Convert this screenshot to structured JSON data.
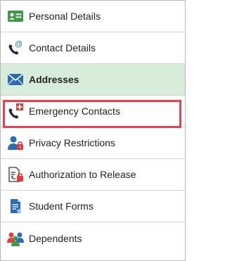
{
  "menu": {
    "items": [
      {
        "label": "Personal Details",
        "icon": "id-card-icon",
        "active": false
      },
      {
        "label": "Contact Details",
        "icon": "phone-at-icon",
        "active": false
      },
      {
        "label": "Addresses",
        "icon": "envelope-icon",
        "active": true
      },
      {
        "label": "Emergency Contacts",
        "icon": "phone-medical-icon",
        "active": false,
        "highlighted": true
      },
      {
        "label": "Privacy Restrictions",
        "icon": "user-lock-icon",
        "active": false
      },
      {
        "label": "Authorization to Release",
        "icon": "document-lock-icon",
        "active": false
      },
      {
        "label": "Student Forms",
        "icon": "form-document-icon",
        "active": false
      },
      {
        "label": "Dependents",
        "icon": "people-icon",
        "active": false
      }
    ]
  },
  "colors": {
    "active_background": "#d7ecd9",
    "highlight_border": "#e8424e",
    "icon_green": "#3c9a49",
    "icon_blue": "#2a6db5",
    "icon_red": "#e23b3b"
  }
}
